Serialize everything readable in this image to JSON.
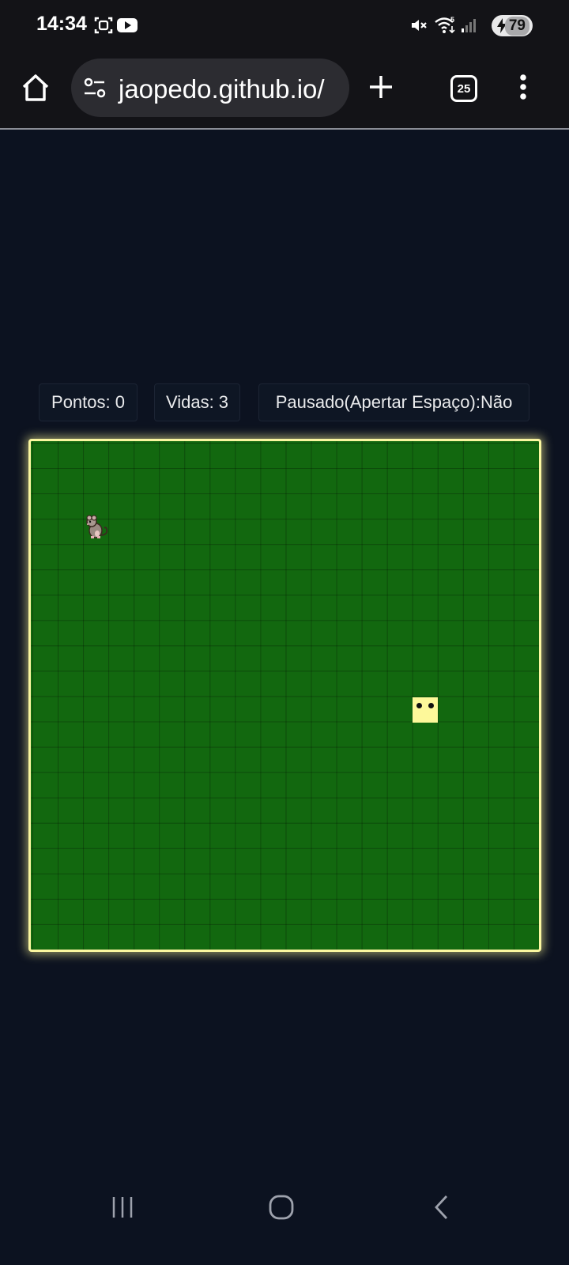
{
  "status_bar": {
    "time": "14:34",
    "battery": "79",
    "network": "5"
  },
  "browser": {
    "url": "jaopedo.github.io/",
    "tab_count": "25"
  },
  "hud": {
    "score": "Pontos: 0",
    "lives": "Vidas: 3",
    "paused": "Pausado(Apertar Espaço):Não"
  },
  "game": {
    "grid_size": 20,
    "rat_cell": {
      "col": 2,
      "row": 3
    },
    "snake_head_cell": {
      "col": 15,
      "row": 10
    },
    "colors": {
      "background": "#0c1220",
      "board": "#12680f",
      "border_glow": "#fbf7a0",
      "snake": "#fdf89a"
    }
  },
  "icons": {
    "home": "home-icon",
    "site_settings": "tune-icon",
    "new_tab": "plus-icon",
    "menu": "more-vert-icon",
    "recents": "recents-icon",
    "nav_home": "nav-home-icon",
    "back": "back-icon"
  }
}
